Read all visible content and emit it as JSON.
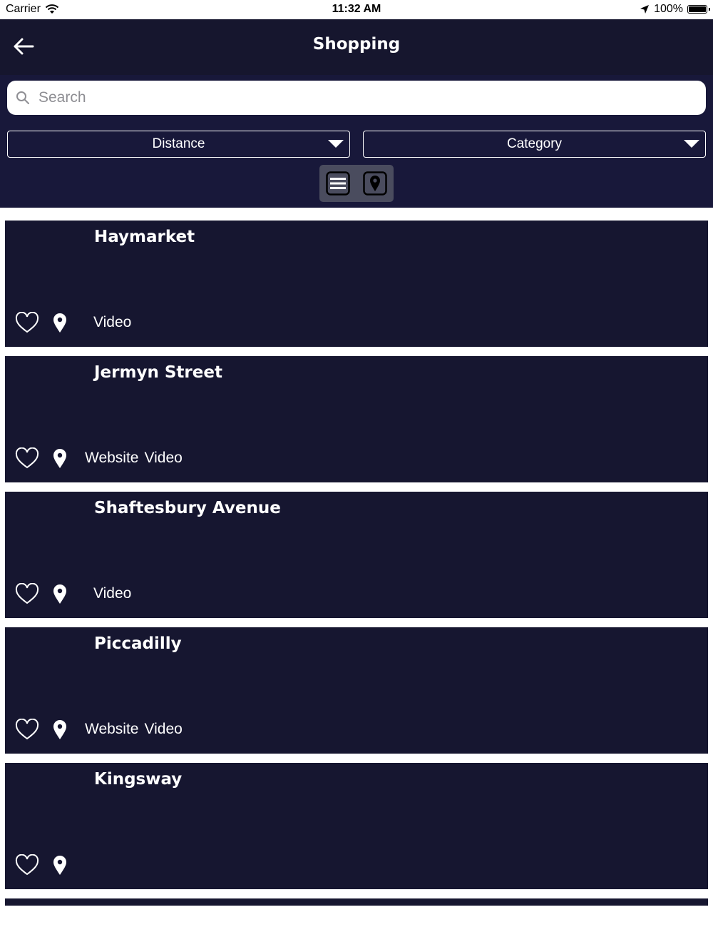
{
  "status_bar": {
    "carrier": "Carrier",
    "time": "11:32 AM",
    "battery_text": "100%",
    "battery_level": 1.0
  },
  "header": {
    "title": "Shopping",
    "background": "#16162e"
  },
  "search": {
    "placeholder": "Search",
    "value": ""
  },
  "filters": {
    "distance_label": "Distance",
    "category_label": "Category"
  },
  "view_toggle": {
    "list_icon": "list-icon",
    "map_icon": "map-pin-icon"
  },
  "places": [
    {
      "name": "Haymarket",
      "website": "",
      "video": "Video"
    },
    {
      "name": "Jermyn Street",
      "website": "Website",
      "video": "Video"
    },
    {
      "name": "Shaftesbury Avenue",
      "website": "",
      "video": "Video"
    },
    {
      "name": "Piccadilly",
      "website": "Website",
      "video": "Video"
    },
    {
      "name": "Kingsway",
      "website": "",
      "video": ""
    }
  ],
  "colors": {
    "card": "#161630",
    "text": "#ffffff"
  }
}
